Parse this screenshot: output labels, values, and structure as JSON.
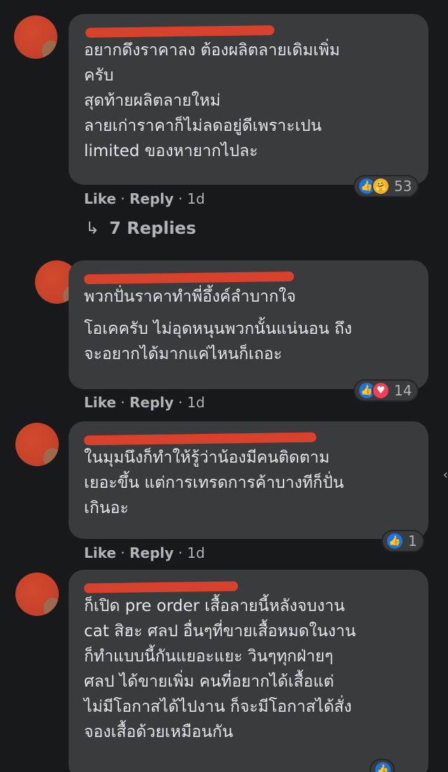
{
  "comments": [
    {
      "author": "",
      "lines": [
        "อยากดึงราคาลง ต้องผลิตลายเดิมเพิ่ม",
        "ครับ",
        "สุดท้ายผลิตลายใหม่",
        "ลายเก่าราคาก็ไม่ลดอยู่ดีเพราะเปน",
        "limited ของหายากไปละ"
      ],
      "like_label": "Like",
      "reply_label": "Reply",
      "time": "1d",
      "reaction_icons": [
        "like-icon",
        "care-icon"
      ],
      "reaction_count": "53",
      "replies_label": "7 Replies"
    },
    {
      "author": "",
      "lines": [
        "พวกปั่นราคาทำพี่อึ้งค์ลำบากใจ",
        "โอเคครับ ไม่อุดหนุนพวกนั้นแน่นอน ถึง",
        "จะอยากได้มากแค่ไหนก็เถอะ"
      ],
      "like_label": "Like",
      "reply_label": "Reply",
      "time": "1d",
      "reaction_icons": [
        "like-icon",
        "love-icon"
      ],
      "reaction_count": "14"
    },
    {
      "author": "",
      "lines": [
        "ในมุมนึงก็ทำให้รู้ว่าน้องมีคนติดตาม",
        "เยอะขึ้น แต่การเทรดการค้าบางทีก็ปั่น",
        "เกินอะ"
      ],
      "like_label": "Like",
      "reply_label": "Reply",
      "time": "1d",
      "reaction_icons": [
        "like-icon"
      ],
      "reaction_count": "1"
    },
    {
      "author": "",
      "lines": [
        "ก็เปิด pre order เสื้อลายนี้หลังจบงาน",
        "cat สิฮะ ศลป อื่นๆที่ขายเสื้อหมดในงาน",
        "ก็ทำแบบนี้กันแยอะแยะ วินๆทุกฝ่ายๆ",
        "ศลป ได้ขายเพิ่ม คนที่อยากได้เสื้อแต่",
        "ไม่มีโอกาสได้ไปงาน ก็จะมีโอกาสได้สั่ง",
        "จองเสื้อด้วยเหมือนกัน"
      ],
      "reaction_icons": [
        "like-icon"
      ]
    }
  ],
  "colors": {
    "background": "#18191a",
    "bubble": "#3a3b3c",
    "text": "#e4e6eb",
    "secondary_text": "#b0b3b8",
    "like_blue": "#1b74e4",
    "love_red": "#f33e58",
    "redaction": "#d8412c"
  }
}
